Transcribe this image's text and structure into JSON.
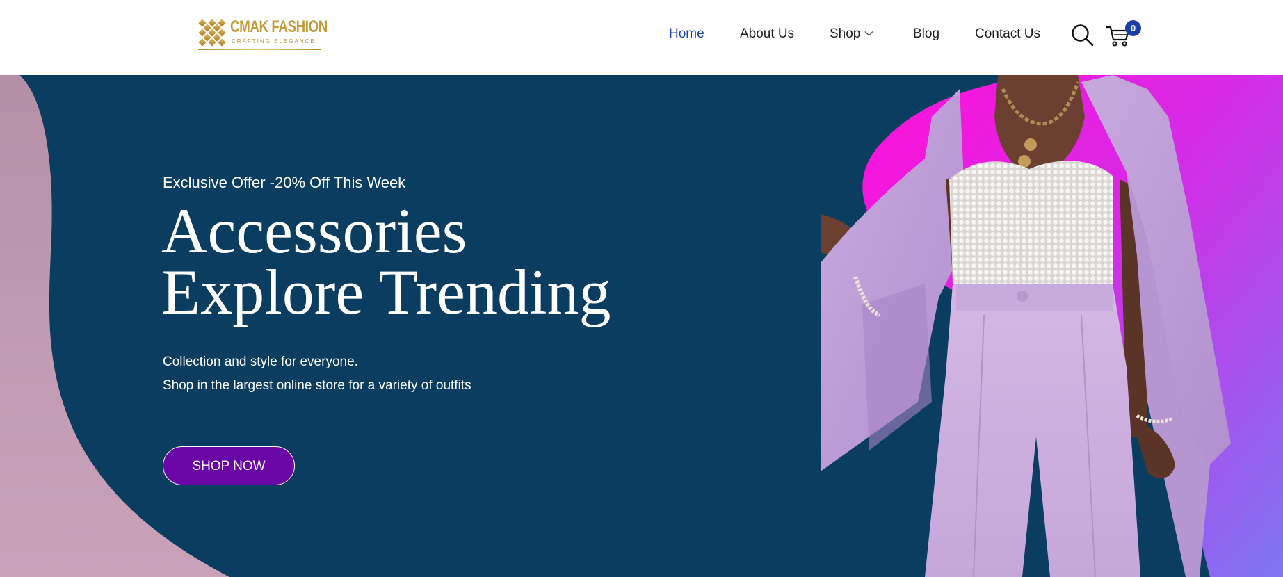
{
  "brand": {
    "name": "CMAK FASHION",
    "tagline": "CRAFTING ELEGANCE",
    "gold": "#c59a3b"
  },
  "nav": {
    "items": [
      {
        "label": "Home",
        "active": true
      },
      {
        "label": "About Us",
        "active": false
      },
      {
        "label": "Shop",
        "active": false,
        "has_dropdown": true
      },
      {
        "label": "Blog",
        "active": false
      },
      {
        "label": "Contact Us",
        "active": false
      }
    ],
    "active_color": "#1b3fa8",
    "search_icon": "search-icon",
    "cart_icon": "cart-icon",
    "cart_count": "0"
  },
  "hero": {
    "offer": "Exclusive Offer -20% Off This Week",
    "headline_line1": "Accessories",
    "headline_line2": "Explore Trending",
    "desc_line1": "Collection and style for everyone.",
    "desc_line2": "Shop in the largest online store for a variety of outfits",
    "cta_label": "SHOP NOW",
    "colors": {
      "background": "#0a3d5f",
      "cta": "#6a06a6",
      "accent_magenta": "#e414d6",
      "accent_violet": "#8a6cf0",
      "wave_mauve": "#c89bb2"
    }
  }
}
